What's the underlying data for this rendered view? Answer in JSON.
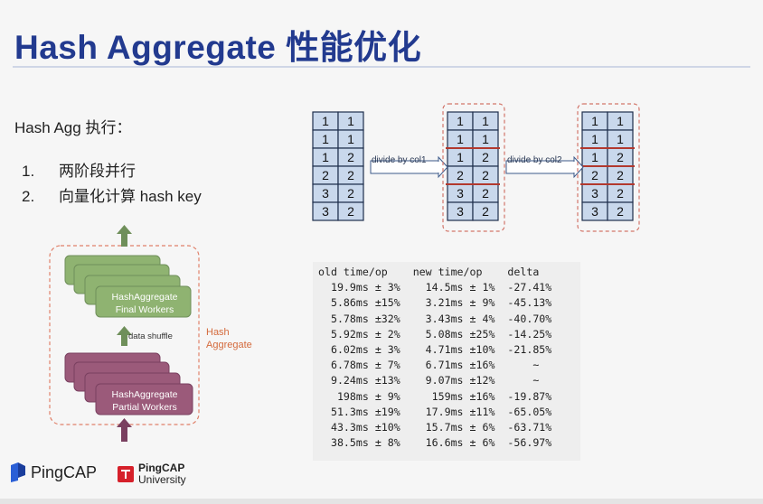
{
  "slide": {
    "title": "Hash Aggregate 性能优化",
    "subtitle": "Hash Agg 执行：",
    "list": [
      {
        "num": "1.",
        "text": "两阶段并行"
      },
      {
        "num": "2.",
        "text": "向量化计算 hash key"
      }
    ]
  },
  "diagram": {
    "arrow1_label": "divide by col1",
    "arrow2_label": "divide by col2",
    "table_rows": [
      [
        "1",
        "1"
      ],
      [
        "1",
        "1"
      ],
      [
        "1",
        "2"
      ],
      [
        "2",
        "2"
      ],
      [
        "3",
        "2"
      ],
      [
        "3",
        "2"
      ]
    ]
  },
  "workers": {
    "final_label_1": "HashAggregate",
    "final_label_2": "Final Workers",
    "shuffle_label": "data shuffle",
    "partial_label_1": "HashAggregate",
    "partial_label_2": "Partial Workers",
    "hash_label_1": "Hash",
    "hash_label_2": "Aggregate",
    "colors": {
      "final": "#8fb371",
      "partial": "#9b5a7a",
      "dash": "#e0816a",
      "hash_text": "#d46a3c"
    }
  },
  "benchmark": {
    "header": "old time/op    new time/op    delta",
    "rows": [
      "  19.9ms ± 3%    14.5ms ± 1%  -27.41%",
      "  5.86ms ±15%    3.21ms ± 9%  -45.13%",
      "  5.78ms ±32%    3.43ms ± 4%  -40.70%",
      "  5.92ms ± 2%    5.08ms ±25%  -14.25%",
      "  6.02ms ± 3%    4.71ms ±10%  -21.85%",
      "  6.78ms ± 7%    6.71ms ±16%      ~",
      "  9.24ms ±13%    9.07ms ±12%      ~",
      "   198ms ± 9%     159ms ±16%  -19.87%",
      "  51.3ms ±19%    17.9ms ±11%  -65.05%",
      "  43.3ms ±10%    15.7ms ± 6%  -63.71%",
      "  38.5ms ± 8%    16.6ms ± 6%  -56.97%"
    ]
  },
  "footer": {
    "pingcap": "PingCAP",
    "univ_1": "PingCAP",
    "univ_2": "University"
  }
}
